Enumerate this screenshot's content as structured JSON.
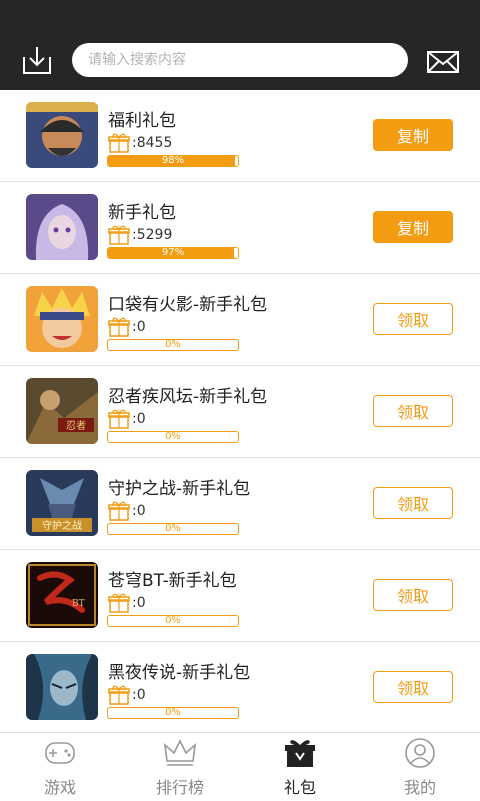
{
  "header": {
    "search_placeholder": "请输入搜索内容",
    "download_icon": "download-icon",
    "mail_icon": "mail-icon"
  },
  "colors": {
    "accent": "#f39c12",
    "header_bg": "#262626"
  },
  "gifts": [
    {
      "name": "福利礼包",
      "count": ":8455",
      "progress_label": "98%",
      "progress": 0.98,
      "button": "复制",
      "button_style": "filled"
    },
    {
      "name": "新手礼包",
      "count": ":5299",
      "progress_label": "97%",
      "progress": 0.97,
      "button": "复制",
      "button_style": "filled"
    },
    {
      "name": "口袋有火影-新手礼包",
      "count": ":0",
      "progress_label": "0%",
      "progress": 0,
      "button": "领取",
      "button_style": "outline"
    },
    {
      "name": "忍者疾风坛-新手礼包",
      "count": ":0",
      "progress_label": "0%",
      "progress": 0,
      "button": "领取",
      "button_style": "outline"
    },
    {
      "name": "守护之战-新手礼包",
      "count": ":0",
      "progress_label": "0%",
      "progress": 0,
      "button": "领取",
      "button_style": "outline"
    },
    {
      "name": "苍穹BT-新手礼包",
      "count": ":0",
      "progress_label": "0%",
      "progress": 0,
      "button": "领取",
      "button_style": "outline"
    },
    {
      "name": "黑夜传说-新手礼包",
      "count": ":0",
      "progress_label": "0%",
      "progress": 0,
      "button": "领取",
      "button_style": "outline"
    }
  ],
  "tabs": [
    {
      "label": "游戏",
      "icon": "gamepad-icon",
      "active": false
    },
    {
      "label": "排行榜",
      "icon": "crown-icon",
      "active": false
    },
    {
      "label": "礼包",
      "icon": "gift-box-icon",
      "active": true
    },
    {
      "label": "我的",
      "icon": "user-icon",
      "active": false
    }
  ]
}
